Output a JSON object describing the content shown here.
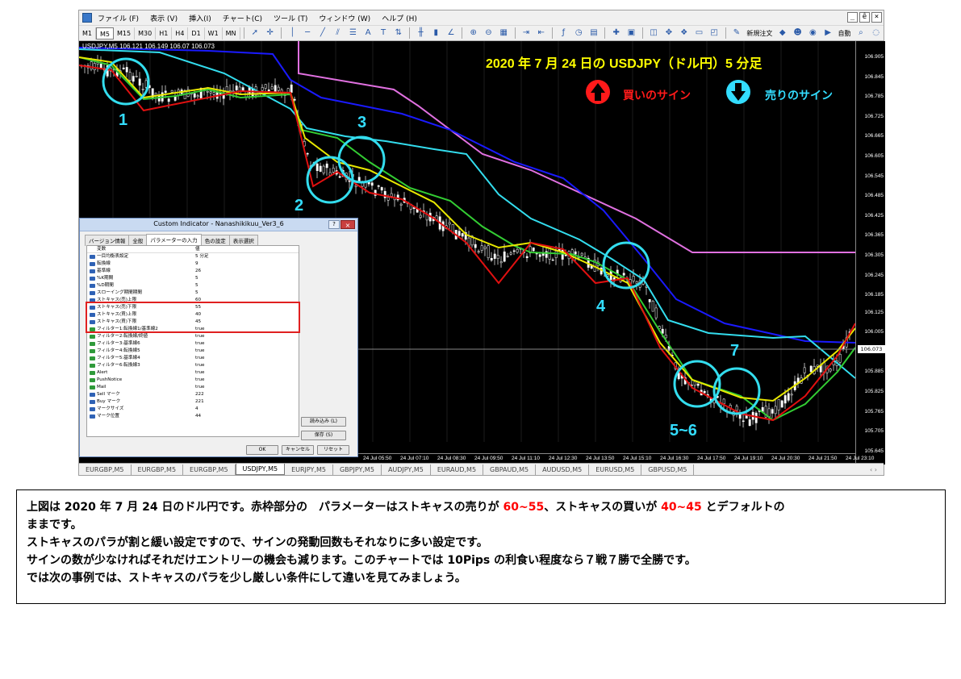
{
  "menubar": {
    "items": [
      "ファイル (F)",
      "表示 (V)",
      "挿入(I)",
      "チャート(C)",
      "ツール (T)",
      "ウィンドウ (W)",
      "ヘルプ (H)"
    ],
    "window_controls": [
      "_",
      "ê",
      "×"
    ]
  },
  "toolbar": {
    "timeframes": [
      "M1",
      "M5",
      "M15",
      "M30",
      "H1",
      "H4",
      "D1",
      "W1",
      "MN"
    ],
    "active_timeframe": "M5",
    "new_order_label": "新規注文",
    "auto_trading_label": "自動"
  },
  "chart": {
    "symbol_label": "USDJPY,M5  106.121 106.149 106.07 106.073",
    "title": "2020 年 7 月 24 日の USDJPY（ドル円）5 分足",
    "buy_signal_label": "買いのサイン",
    "sell_signal_label": "売りのサイン",
    "buy_arrow_color": "#ff1a1a",
    "sell_arrow_color": "#33ddff",
    "marker_numbers": [
      "1",
      "2",
      "3",
      "4",
      "5~6",
      "7"
    ],
    "current_price": "106.073",
    "price_ticks": [
      "106.905",
      "106.845",
      "106.785",
      "106.725",
      "106.665",
      "106.605",
      "106.545",
      "106.485",
      "106.425",
      "106.365",
      "106.305",
      "106.245",
      "106.185",
      "106.125",
      "106.005",
      "105.945",
      "105.885",
      "105.825",
      "105.765",
      "105.705",
      "105.645"
    ],
    "time_ticks": [
      "24 Jul 05:50",
      "24 Jul 07:10",
      "24 Jul 08:30",
      "24 Jul 09:50",
      "24 Jul 11:10",
      "24 Jul 12:30",
      "24 Jul 13:50",
      "24 Jul 15:10",
      "24 Jul 16:30",
      "24 Jul 17:50",
      "24 Jul 19:10",
      "24 Jul 20:30",
      "24 Jul 21:50",
      "24 Jul 23:10"
    ],
    "line_colors": {
      "red": "#e01010",
      "yellow": "#e8e800",
      "green": "#33cc33",
      "cyan": "#33ddee",
      "blue": "#1a1aff",
      "violet": "#e070e0"
    }
  },
  "tabs": {
    "items": [
      "EURGBP,M5",
      "EURGBP,M5",
      "EURGBP,M5",
      "USDJPY,M5",
      "EURJPY,M5",
      "GBPJPY,M5",
      "AUDJPY,M5",
      "EURAUD,M5",
      "GBPAUD,M5",
      "AUDUSD,M5",
      "EURUSD,M5",
      "GBPUSD,M5"
    ],
    "active": "USDJPY,M5",
    "nav": "‹ ›"
  },
  "dialog": {
    "title": "Custom Indicator - Nanashikikuu_Ver3_6",
    "help": "?",
    "close": "×",
    "tabs": [
      "バージョン情報",
      "全般",
      "パラメーターの入力",
      "色の設定",
      "表示選択"
    ],
    "active_tab": "パラメーターの入力",
    "header": {
      "name": "変数",
      "value": "値"
    },
    "params": [
      {
        "name": "一目均衡表設定",
        "value": "5 分足",
        "type": "num"
      },
      {
        "name": "転換線",
        "value": "9",
        "type": "num"
      },
      {
        "name": "基準線",
        "value": "26",
        "type": "num"
      },
      {
        "name": "%K期間",
        "value": "5",
        "type": "num"
      },
      {
        "name": "%D期間",
        "value": "5",
        "type": "num"
      },
      {
        "name": "スローイング期間期間",
        "value": "5",
        "type": "num"
      },
      {
        "name": "ストキャス(売)上限",
        "value": "60",
        "type": "num"
      },
      {
        "name": "ストキャス(売)下限",
        "value": "55",
        "type": "num"
      },
      {
        "name": "ストキャス(買)上限",
        "value": "40",
        "type": "num"
      },
      {
        "name": "ストキャス(買)下限",
        "value": "45",
        "type": "num"
      },
      {
        "name": "フィルター1:転換線1/基準線2",
        "value": "true",
        "type": "bool"
      },
      {
        "name": "フィルター2:転換線/終値",
        "value": "true",
        "type": "bool"
      },
      {
        "name": "フィルター3:基準線6",
        "value": "true",
        "type": "bool"
      },
      {
        "name": "フィルター4:転換線5",
        "value": "true",
        "type": "bool"
      },
      {
        "name": "フィルター5:基準線4",
        "value": "true",
        "type": "bool"
      },
      {
        "name": "フィルター6:転換線3",
        "value": "true",
        "type": "bool"
      },
      {
        "name": "Alert",
        "value": "true",
        "type": "bool"
      },
      {
        "name": "PushNotice",
        "value": "true",
        "type": "bool"
      },
      {
        "name": "Mail",
        "value": "true",
        "type": "bool"
      },
      {
        "name": "Sell マーク",
        "value": "222",
        "type": "num"
      },
      {
        "name": "Buy マーク",
        "value": "221",
        "type": "num"
      },
      {
        "name": "マークサイズ",
        "value": "4",
        "type": "num"
      },
      {
        "name": "マーク位置",
        "value": "44",
        "type": "num"
      }
    ],
    "buttons": {
      "load": "読み込み (L)",
      "save": "保存 (S)",
      "ok": "OK",
      "cancel": "キャンセル",
      "reset": "リセット"
    }
  },
  "caption": {
    "line1_a": "上図は 2020 年 7 月 24 日のドル円です。赤枠部分の　パラメーターはストキャスの売りが ",
    "line1_red1": "60~55",
    "line1_b": "、ストキャスの買いが ",
    "line1_red2": "40~45",
    "line1_c": " とデフォルトの",
    "line2": "ままです。",
    "line3": "ストキャスのパラが割と緩い設定ですので、サインの発動回数もそれなりに多い設定です。",
    "line4": "サインの数が少なければそれだけエントリーの機会も減ります。このチャートでは 10Pips の利食い程度なら７戦７勝で全勝です。",
    "line5": "では次の事例では、ストキャスのパラを少し厳しい条件にして違いを見てみましょう。"
  }
}
